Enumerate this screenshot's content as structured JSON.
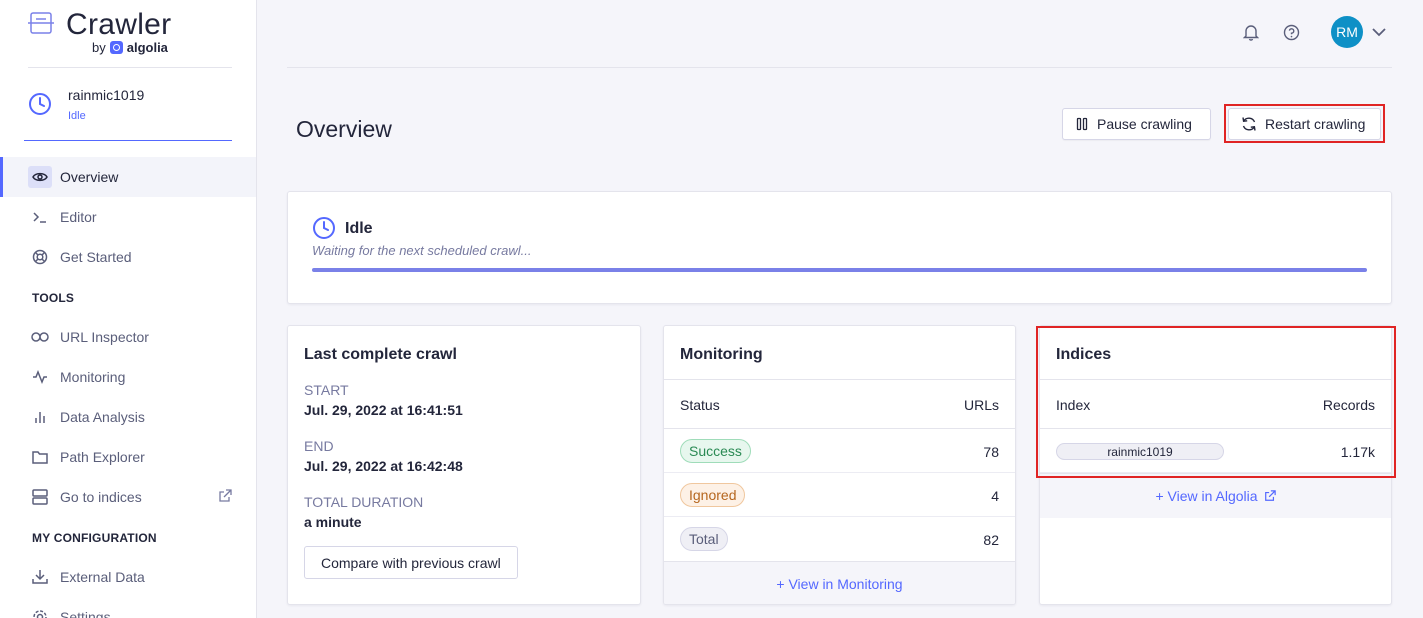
{
  "app": {
    "title": "Crawler",
    "by_label": "by",
    "brand": "algolia"
  },
  "crawler": {
    "name": "rainmic1019",
    "status": "Idle"
  },
  "sidebar": {
    "items": [
      {
        "label": "Overview",
        "icon": "eye-icon",
        "active": true
      },
      {
        "label": "Editor",
        "icon": "terminal-icon"
      },
      {
        "label": "Get Started",
        "icon": "lifebuoy-icon"
      }
    ],
    "tools_section": "TOOLS",
    "tools": [
      {
        "label": "URL Inspector",
        "icon": "link-icon"
      },
      {
        "label": "Monitoring",
        "icon": "activity-icon"
      },
      {
        "label": "Data Analysis",
        "icon": "bar-chart-icon"
      },
      {
        "label": "Path Explorer",
        "icon": "folder-icon"
      },
      {
        "label": "Go to indices",
        "icon": "server-icon",
        "external": true
      }
    ],
    "config_section": "MY CONFIGURATION",
    "config": [
      {
        "label": "External Data",
        "icon": "download-icon"
      },
      {
        "label": "Settings",
        "icon": "gear-icon"
      }
    ]
  },
  "header": {
    "avatar_initials": "RM",
    "avatar_color": "#0e90c6"
  },
  "page": {
    "title": "Overview",
    "pause_label": "Pause crawling",
    "restart_label": "Restart crawling"
  },
  "status_card": {
    "title": "Idle",
    "subtitle": "Waiting for the next scheduled crawl...",
    "progress": 1.0
  },
  "last_crawl": {
    "title": "Last complete crawl",
    "start_label": "START",
    "start_value": "Jul. 29, 2022 at 16:41:51",
    "end_label": "END",
    "end_value": "Jul. 29, 2022 at 16:42:48",
    "duration_label": "TOTAL DURATION",
    "duration_value": "a minute",
    "compare_label": "Compare with previous crawl"
  },
  "monitoring": {
    "title": "Monitoring",
    "col_status": "Status",
    "col_urls": "URLs",
    "rows": [
      {
        "status": "Success",
        "urls": "78"
      },
      {
        "status": "Ignored",
        "urls": "4"
      },
      {
        "status": "Total",
        "urls": "82"
      }
    ],
    "footer_label": "+ View in Monitoring"
  },
  "indices": {
    "title": "Indices",
    "col_index": "Index",
    "col_records": "Records",
    "rows": [
      {
        "index": "rainmic1019",
        "records": "1.17k"
      }
    ],
    "footer_label": "+ View in Algolia"
  },
  "colors": {
    "accent": "#5468ff",
    "highlight": "#e02424"
  }
}
